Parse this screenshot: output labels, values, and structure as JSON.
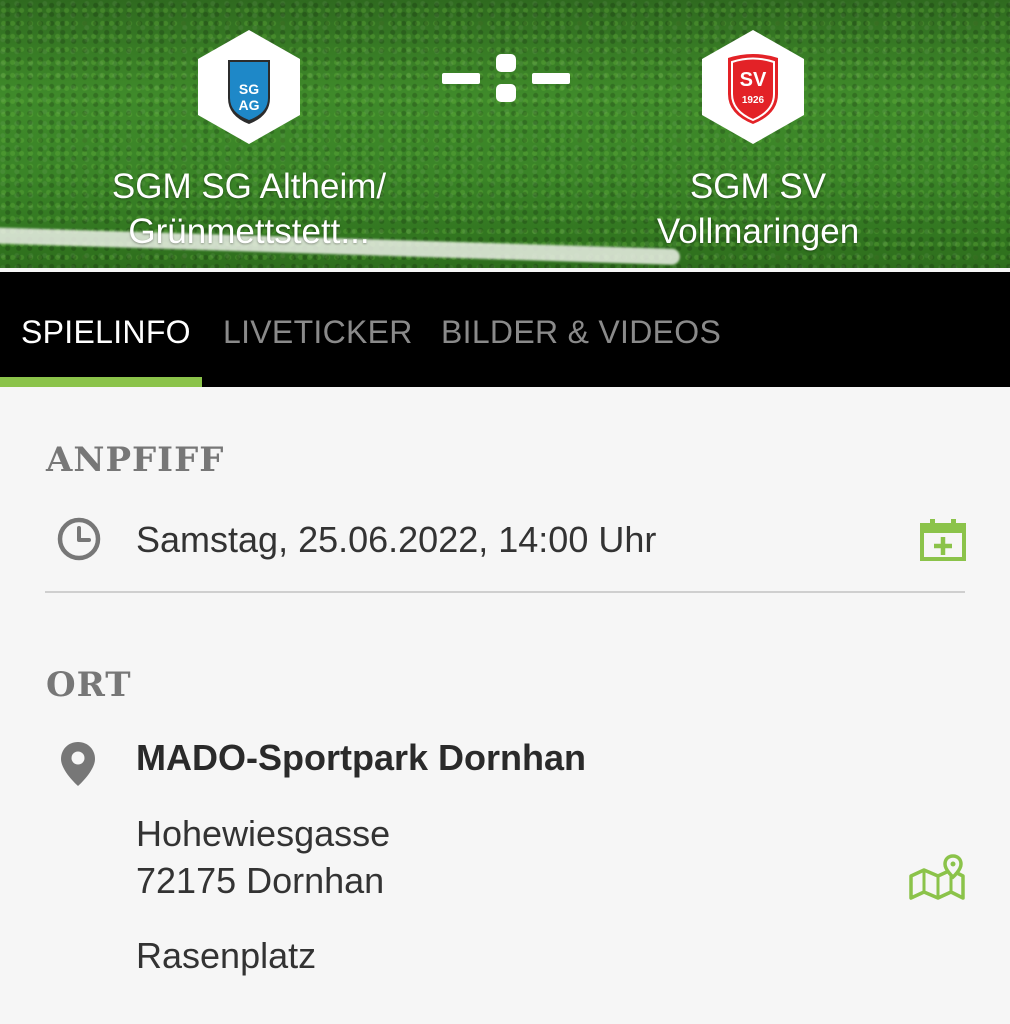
{
  "match": {
    "home_team": {
      "name_line1": "SGM SG Altheim/",
      "name_line2": "Grünmettstett...",
      "crest_text": "SG AG",
      "crest_icon": "sg-altheim-crest-icon"
    },
    "away_team": {
      "name_line1": "SGM SV",
      "name_line2": "Vollmaringen",
      "crest_text": "SV 1926",
      "crest_icon": "sv-vollmaringen-crest-icon"
    },
    "score": "-:-"
  },
  "tabs": [
    {
      "label": "SPIELINFO",
      "active": true
    },
    {
      "label": "LIVETICKER",
      "active": false
    },
    {
      "label": "BILDER & VIDEOS",
      "active": false
    }
  ],
  "anpfiff": {
    "title": "ANPFIFF",
    "datetime": "Samstag, 25.06.2022, 14:00 Uhr",
    "icon": "clock-icon",
    "action_icon": "calendar-add-icon"
  },
  "ort": {
    "title": "ORT",
    "venue": "MADO-Sportpark Dornhan",
    "street": "Hohewiesgasse",
    "city": "72175 Dornhan",
    "surface": "Rasenplatz",
    "icon": "location-pin-icon",
    "action_icon": "map-icon"
  },
  "colors": {
    "accent": "#8bc34a",
    "tab_bar": "#000000",
    "section_title": "#777777",
    "crest_red": "#e32227",
    "crest_blue": "#1e88c8"
  }
}
